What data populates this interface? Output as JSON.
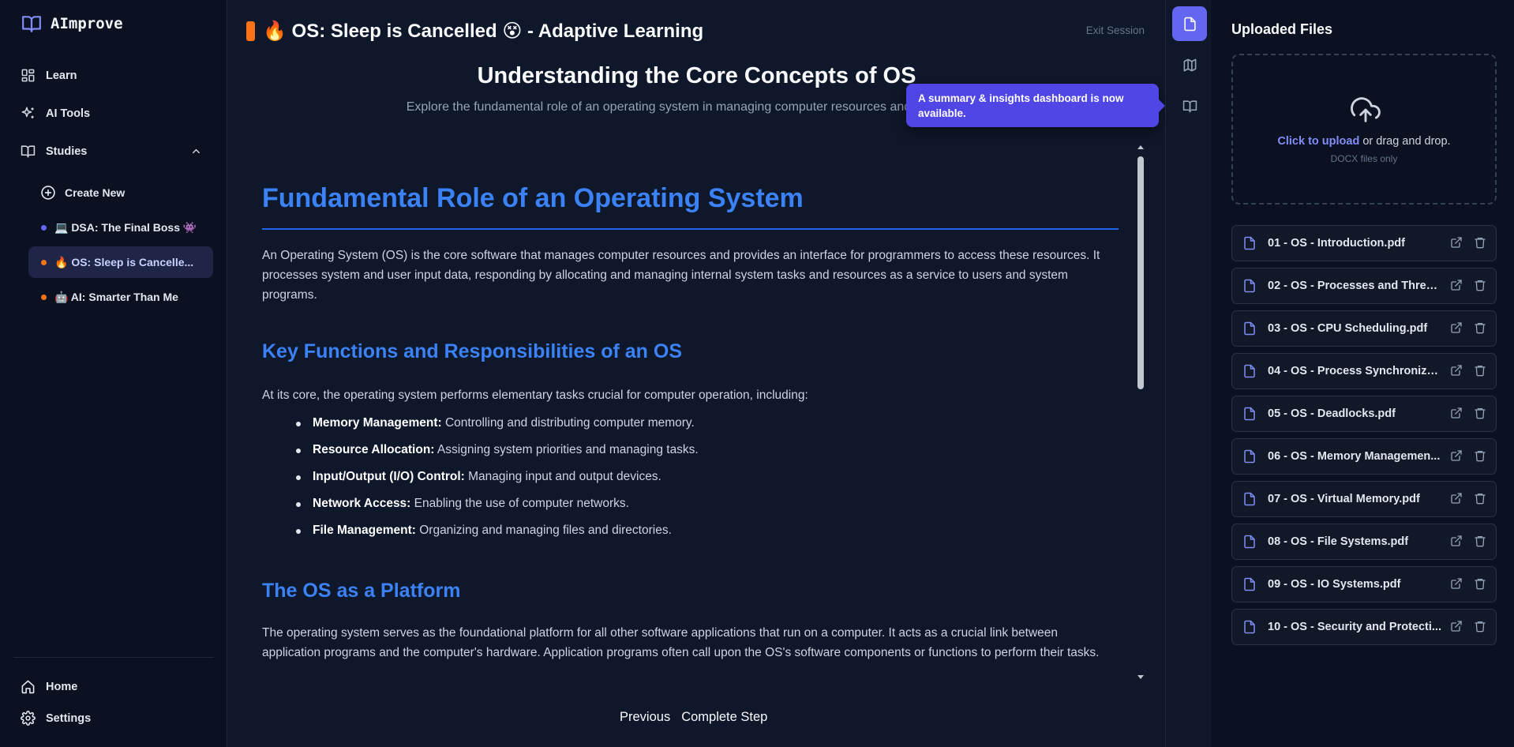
{
  "app": {
    "name": "AImprove",
    "brand_color": "#6366f1"
  },
  "sidebar": {
    "nav": [
      {
        "label": "Learn",
        "icon": "dashboard-icon"
      },
      {
        "label": "AI Tools",
        "icon": "sparkles-icon"
      },
      {
        "label": "Studies",
        "icon": "book-open-icon"
      }
    ],
    "create_new": "Create New",
    "studies": [
      {
        "label": "💻 DSA: The Final Boss 👾",
        "dot_color": "#6366f1",
        "active": false
      },
      {
        "label": "🔥 OS: Sleep is Cancelle...",
        "dot_color": "#f97316",
        "active": true
      },
      {
        "label": "🤖 AI: Smarter Than Me",
        "dot_color": "#f97316",
        "active": false
      }
    ],
    "bottom": [
      {
        "label": "Home",
        "icon": "home-icon"
      },
      {
        "label": "Settings",
        "icon": "gear-icon"
      }
    ]
  },
  "header": {
    "title": "🔥 OS: Sleep is Cancelled 😵 - Adaptive Learning",
    "exit_label": "Exit Session"
  },
  "lesson": {
    "title": "Understanding the Core Concepts of OS",
    "subtitle": "Explore the fundamental role of an operating system in managing computer resources and providing a p"
  },
  "toast": {
    "text": "A summary & insights dashboard is now available."
  },
  "content": {
    "h1": "Fundamental Role of an Operating System",
    "intro": "An Operating System (OS) is the core software that manages computer resources and provides an interface for programmers to access these resources. It processes system and user input data, responding by allocating and managing internal system tasks and resources as a service to users and system programs.",
    "h2_functions": "Key Functions and Responsibilities of an OS",
    "functions_intro": "At its core, the operating system performs elementary tasks crucial for computer operation, including:",
    "functions": [
      {
        "term": "Memory Management:",
        "desc": " Controlling and distributing computer memory."
      },
      {
        "term": "Resource Allocation:",
        "desc": " Assigning system priorities and managing tasks."
      },
      {
        "term": "Input/Output (I/O) Control:",
        "desc": " Managing input and output devices."
      },
      {
        "term": "Network Access:",
        "desc": " Enabling the use of computer networks."
      },
      {
        "term": "File Management:",
        "desc": " Organizing and managing files and directories."
      }
    ],
    "h2_platform": "The OS as a Platform",
    "platform_text": "The operating system serves as the foundational platform for all other software applications that run on a computer. It acts as a crucial link between application programs and the computer's hardware. Application programs often call upon the OS's software components or functions to perform their tasks."
  },
  "footer": {
    "previous": "Previous",
    "complete": "Complete Step"
  },
  "files_panel": {
    "title": "Uploaded Files",
    "upload_link": "Click to upload",
    "upload_rest": " or drag and drop.",
    "upload_hint": "DOCX files only",
    "files": [
      "01 - OS - Introduction.pdf",
      "02 - OS - Processes and Threa...",
      "03 - OS - CPU Scheduling.pdf",
      "04 - OS - Process Synchroniza...",
      "05 - OS - Deadlocks.pdf",
      "06 - OS - Memory Managemen...",
      "07 - OS - Virtual Memory.pdf",
      "08 - OS - File Systems.pdf",
      "09 - OS - IO Systems.pdf",
      "10 - OS - Security and Protecti..."
    ]
  }
}
